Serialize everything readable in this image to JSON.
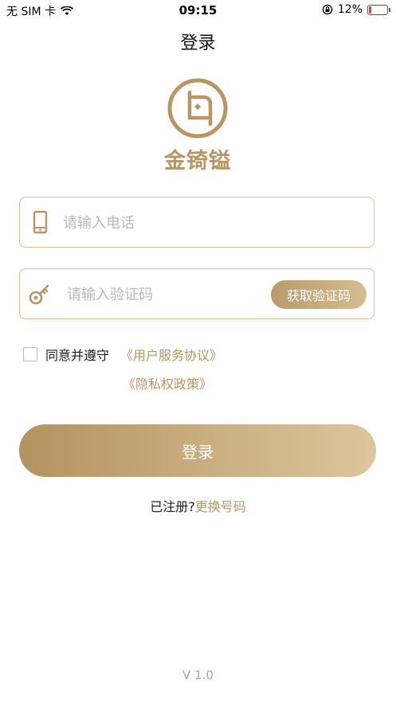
{
  "status_bar": {
    "carrier": "无 SIM 卡",
    "time": "09:15",
    "battery_percent": "12%",
    "battery_level": 0.12
  },
  "nav": {
    "title": "登录"
  },
  "logo": {
    "brand_name": "金锜镒"
  },
  "form": {
    "phone_placeholder": "请输入电话",
    "code_placeholder": "请输入验证码",
    "get_code_label": "获取验证码"
  },
  "agreement": {
    "agree_text": "同意并遵守",
    "user_agreement": "《用户服务协议》",
    "privacy_policy": "《隐私权政策》"
  },
  "login_label": "登录",
  "register": {
    "prompt": "已注册?",
    "change_number": "更换号码"
  },
  "version": "V 1.0",
  "colors": {
    "accent": "#b89563",
    "border": "#d6bf92",
    "gradient_start": "#b3935f",
    "gradient_end": "#dcc69d"
  }
}
